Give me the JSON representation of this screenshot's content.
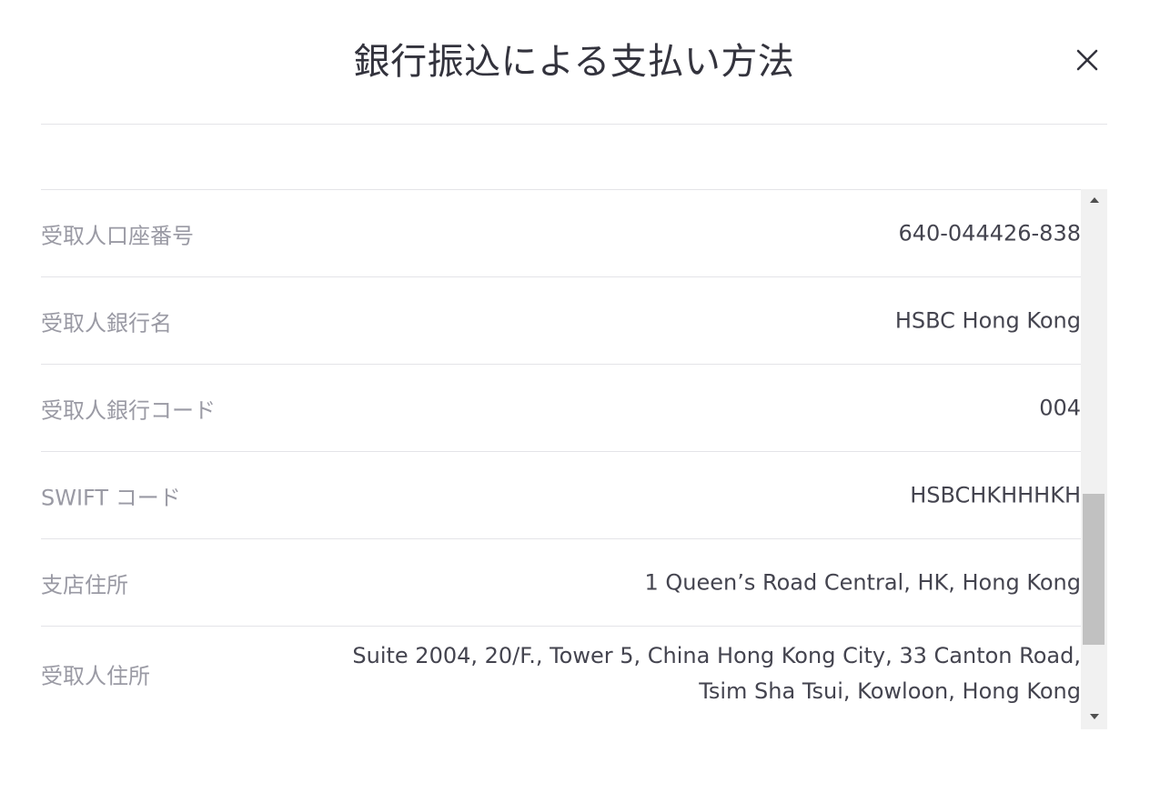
{
  "dialog": {
    "title": "銀行振込による支払い方法",
    "close_icon": "close-icon"
  },
  "details": [
    {
      "label": "受取人口座番号",
      "value_lines": [
        "640-044426-838"
      ]
    },
    {
      "label": "受取人銀行名",
      "value_lines": [
        "HSBC Hong Kong"
      ]
    },
    {
      "label": "受取人銀行コード",
      "value_lines": [
        "004"
      ]
    },
    {
      "label": "SWIFT コード",
      "value_lines": [
        "HSBCHKHHHKH"
      ]
    },
    {
      "label": "支店住所",
      "value_lines": [
        "1 Queen’s Road Central, HK, Hong Kong"
      ]
    },
    {
      "label": "受取人住所",
      "value_lines": [
        "Suite 2004, 20/F., Tower 5, China Hong Kong City, 33 Canton Road,",
        "Tsim Sha Tsui, Kowloon, Hong Kong"
      ]
    }
  ],
  "scrollbar": {
    "up_icon": "triangle-up-icon",
    "down_icon": "triangle-down-icon"
  },
  "colors": {
    "label": "#9a9aa4",
    "value": "#44444f",
    "title": "#33333d",
    "divider": "#e4e4e8",
    "scroll_track": "#f1f1f1",
    "scroll_thumb": "#c1c1c1"
  }
}
